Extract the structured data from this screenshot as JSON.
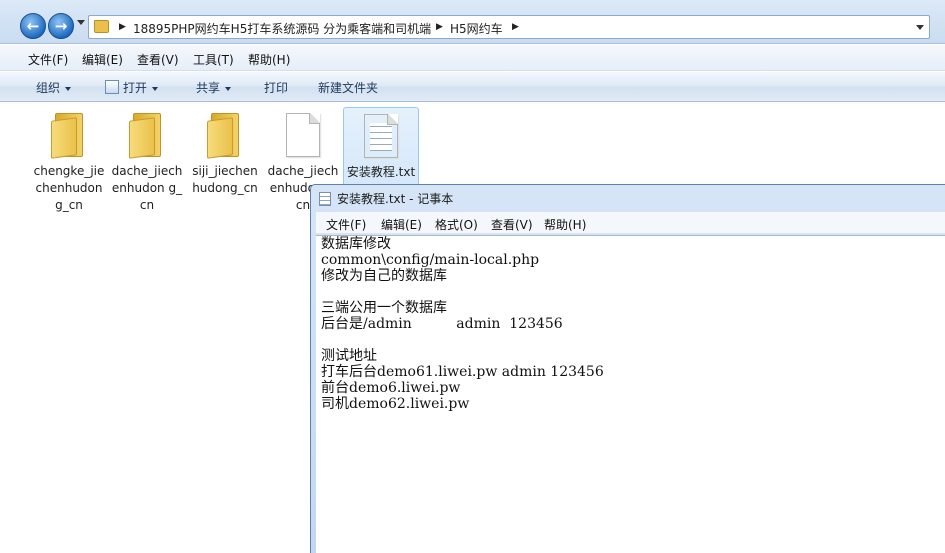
{
  "explorer": {
    "breadcrumbs": [
      "18895PHP网约车H5打车系统源码 分为乘客端和司机端",
      "H5网约车"
    ],
    "menu": [
      "文件(F)",
      "编辑(E)",
      "查看(V)",
      "工具(T)",
      "帮助(H)"
    ],
    "commands": {
      "organize": "组织",
      "open": "打开",
      "share": "共享",
      "print": "打印",
      "new_folder": "新建文件夹"
    },
    "files": [
      {
        "name": "chengke_jiechenhudong_cn",
        "type": "folder",
        "icon": "folder-icon"
      },
      {
        "name": "dache_jiechenhudong_cn",
        "type": "folder",
        "icon": "folder-icon"
      },
      {
        "name": "siji_jiechenhudong_cn",
        "type": "folder",
        "icon": "folder-icon"
      },
      {
        "name": "dache_jiechenhudong_cn",
        "type": "file",
        "icon": "blank-file-icon"
      },
      {
        "name": "安装教程.txt",
        "type": "text-file",
        "icon": "text-file-icon",
        "selected": true
      }
    ],
    "visible_labels": [
      "chengke_jiechenhudong_cn",
      "dache_jiechenhudon g_cn",
      "siji_jiechenhudong_cn",
      "dache_jiechenhudong_cn",
      "安装教程.txt"
    ]
  },
  "notepad": {
    "title": "安装教程.txt - 记事本",
    "menu": [
      "文件(F)",
      "编辑(E)",
      "格式(O)",
      "查看(V)",
      "帮助(H)"
    ],
    "lines": [
      "数据库修改",
      "common\\config/main-local.php",
      "修改为自己的数据库",
      "",
      "三端公用一个数据库",
      "后台是/admin          admin  123456",
      "",
      "测试地址",
      "打车后台demo61.liwei.pw admin 123456",
      "前台demo6.liwei.pw",
      "司机demo62.liwei.pw"
    ]
  }
}
